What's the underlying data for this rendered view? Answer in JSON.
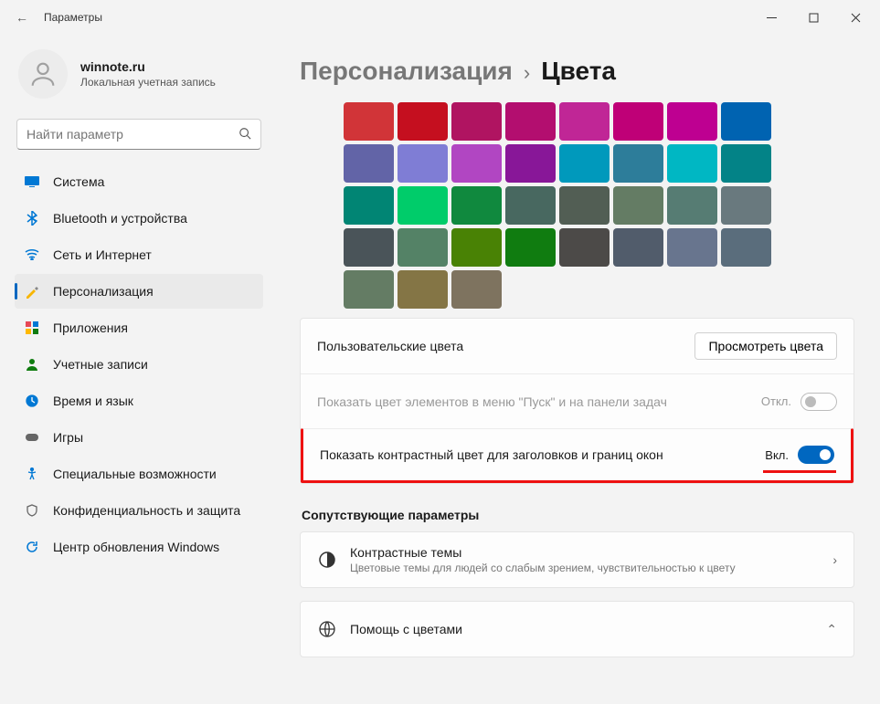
{
  "titlebar": {
    "title": "Параметры"
  },
  "profile": {
    "name": "winnote.ru",
    "sub": "Локальная учетная запись"
  },
  "search": {
    "placeholder": "Найти параметр"
  },
  "sidebar": {
    "items": [
      {
        "label": "Система",
        "icon": "system"
      },
      {
        "label": "Bluetooth и устройства",
        "icon": "bluetooth"
      },
      {
        "label": "Сеть и Интернет",
        "icon": "network"
      },
      {
        "label": "Персонализация",
        "icon": "personalization",
        "active": true
      },
      {
        "label": "Приложения",
        "icon": "apps"
      },
      {
        "label": "Учетные записи",
        "icon": "accounts"
      },
      {
        "label": "Время и язык",
        "icon": "time"
      },
      {
        "label": "Игры",
        "icon": "gaming"
      },
      {
        "label": "Специальные возможности",
        "icon": "accessibility"
      },
      {
        "label": "Конфиденциальность и защита",
        "icon": "privacy"
      },
      {
        "label": "Центр обновления Windows",
        "icon": "update"
      }
    ]
  },
  "breadcrumb": {
    "parent": "Персонализация",
    "sep": "›",
    "current": "Цвета"
  },
  "palette": [
    "#d13438",
    "#c50f1f",
    "#b01461",
    "#b30e6f",
    "#c02696",
    "#bf0077",
    "#be0091",
    "#0063b1",
    "#6264a7",
    "#7f7dd5",
    "#b146c2",
    "#881798",
    "#0099bc",
    "#2d7d9a",
    "#00b7c3",
    "#038387",
    "#018574",
    "#00cc6a",
    "#10893e",
    "#486860",
    "#525e54",
    "#647c64",
    "#567c73",
    "#69797e",
    "#4a5459",
    "#548266",
    "#498205",
    "#107c10",
    "#4c4a48",
    "#515c6b",
    "#68758e",
    "#5a6d7c",
    "#647c64",
    "#847545",
    "#7e735f"
  ],
  "rows": {
    "custom_colors": {
      "label": "Пользовательские цвета",
      "button": "Просмотреть цвета"
    },
    "start_taskbar": {
      "label": "Показать цвет элементов в меню \"Пуск\" и на панели задач",
      "state": "Откл."
    },
    "title_borders": {
      "label": "Показать контрастный цвет для заголовков и границ окон",
      "state": "Вкл."
    }
  },
  "related": {
    "title": "Сопутствующие параметры",
    "contrast": {
      "label": "Контрастные темы",
      "sub": "Цветовые темы для людей со слабым зрением, чувствительностью к цвету"
    },
    "help": {
      "label": "Помощь с цветами"
    }
  }
}
